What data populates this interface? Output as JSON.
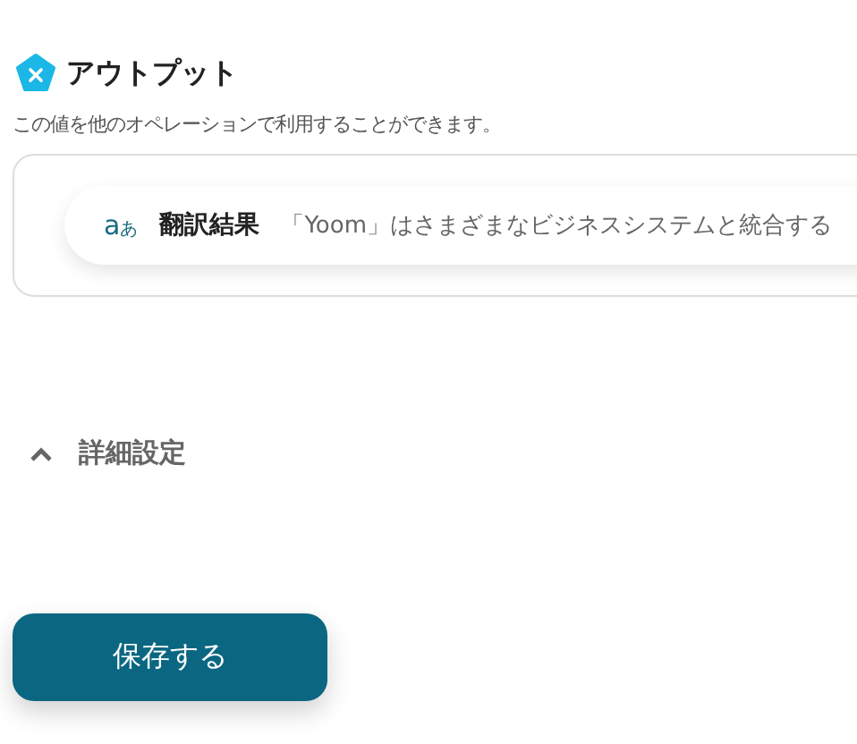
{
  "output": {
    "title": "アウトプット",
    "description": "この値を他のオペレーションで利用することができます。",
    "items": [
      {
        "icon_text": "a",
        "icon_text_small": "あ",
        "label": "翻訳結果",
        "value": "「Yoom」はさまざまなビジネスシステムと統合する"
      }
    ]
  },
  "advanced": {
    "label": "詳細設定",
    "expanded": true
  },
  "save_button": "保存する"
}
